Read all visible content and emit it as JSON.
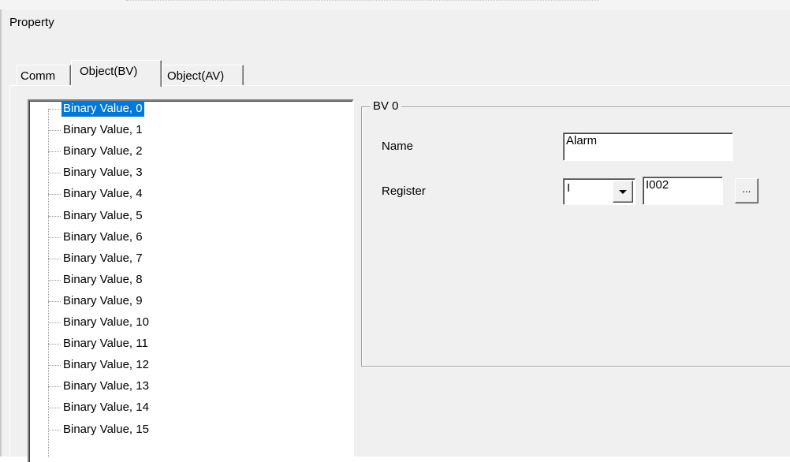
{
  "dialog": {
    "title": "Property"
  },
  "tabs": [
    {
      "label": "Comm",
      "active": false
    },
    {
      "label": "Object(BV)",
      "active": true
    },
    {
      "label": "Object(AV)",
      "active": false
    }
  ],
  "tree": {
    "selected_index": 0,
    "items": [
      "Binary Value, 0",
      "Binary Value, 1",
      "Binary Value, 2",
      "Binary Value, 3",
      "Binary Value, 4",
      "Binary Value, 5",
      "Binary Value, 6",
      "Binary Value, 7",
      "Binary Value, 8",
      "Binary Value, 9",
      "Binary Value, 10",
      "Binary Value, 11",
      "Binary Value, 12",
      "Binary Value, 13",
      "Binary Value, 14",
      "Binary Value, 15"
    ]
  },
  "group": {
    "title": "BV 0",
    "name_label": "Name",
    "name_value": "Alarm",
    "register_label": "Register",
    "register_type": "I",
    "register_value": "I002",
    "browse_label": "..."
  },
  "colors": {
    "selection": "#0078d7",
    "dialog_bg": "#f0f0f0"
  }
}
